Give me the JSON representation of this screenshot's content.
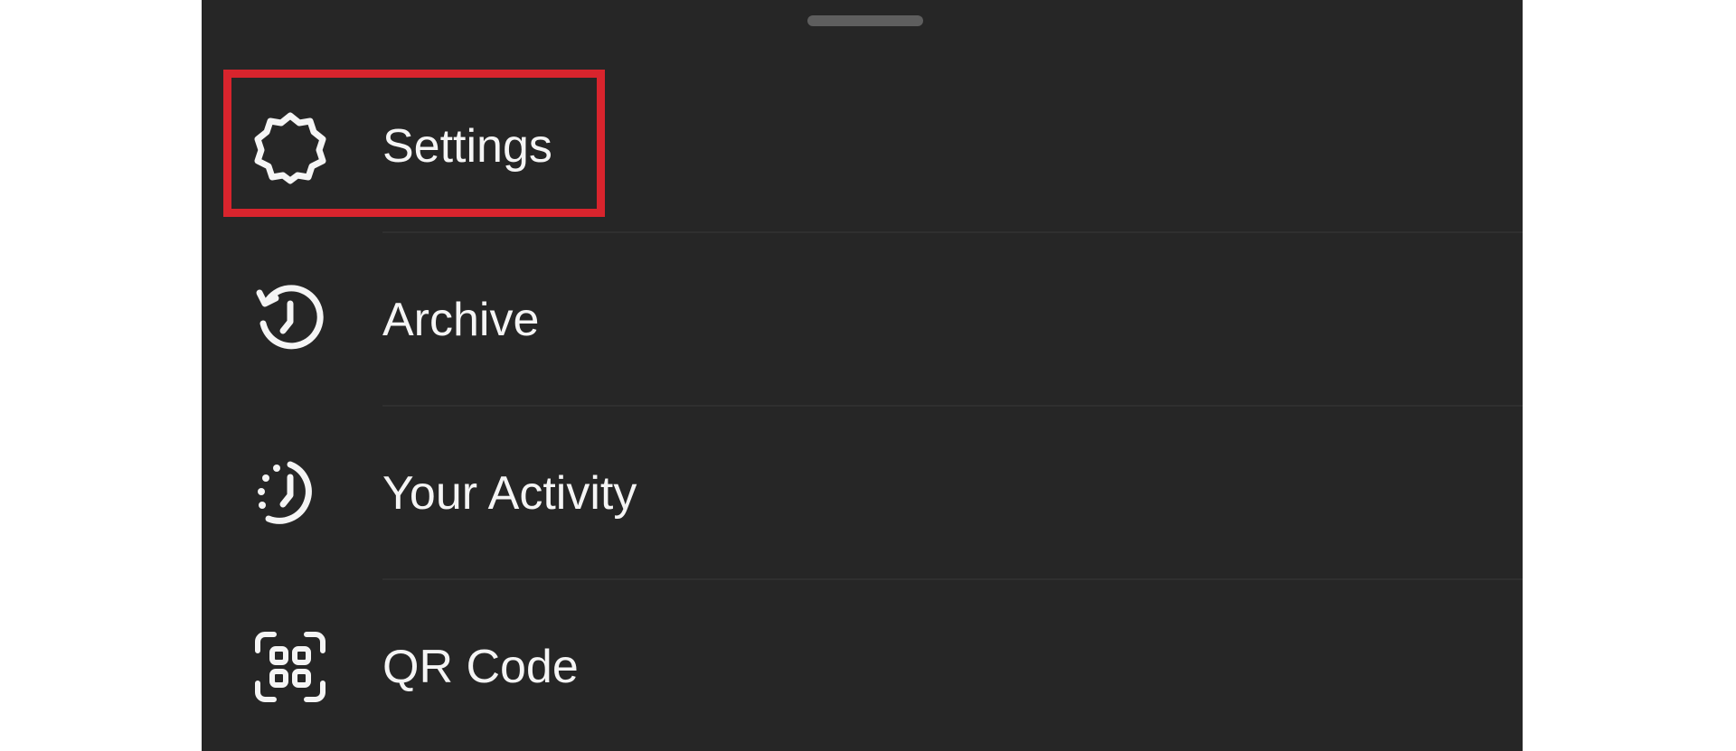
{
  "menu": {
    "items": [
      {
        "label": "Settings",
        "icon": "gear-icon"
      },
      {
        "label": "Archive",
        "icon": "archive-history-icon"
      },
      {
        "label": "Your Activity",
        "icon": "activity-icon"
      },
      {
        "label": "QR Code",
        "icon": "qr-code-icon"
      }
    ]
  },
  "annotation": {
    "highlighted_item": "Settings",
    "color": "#d8242d"
  },
  "colors": {
    "sheet_background": "#262626",
    "text": "#f5f5f5"
  }
}
